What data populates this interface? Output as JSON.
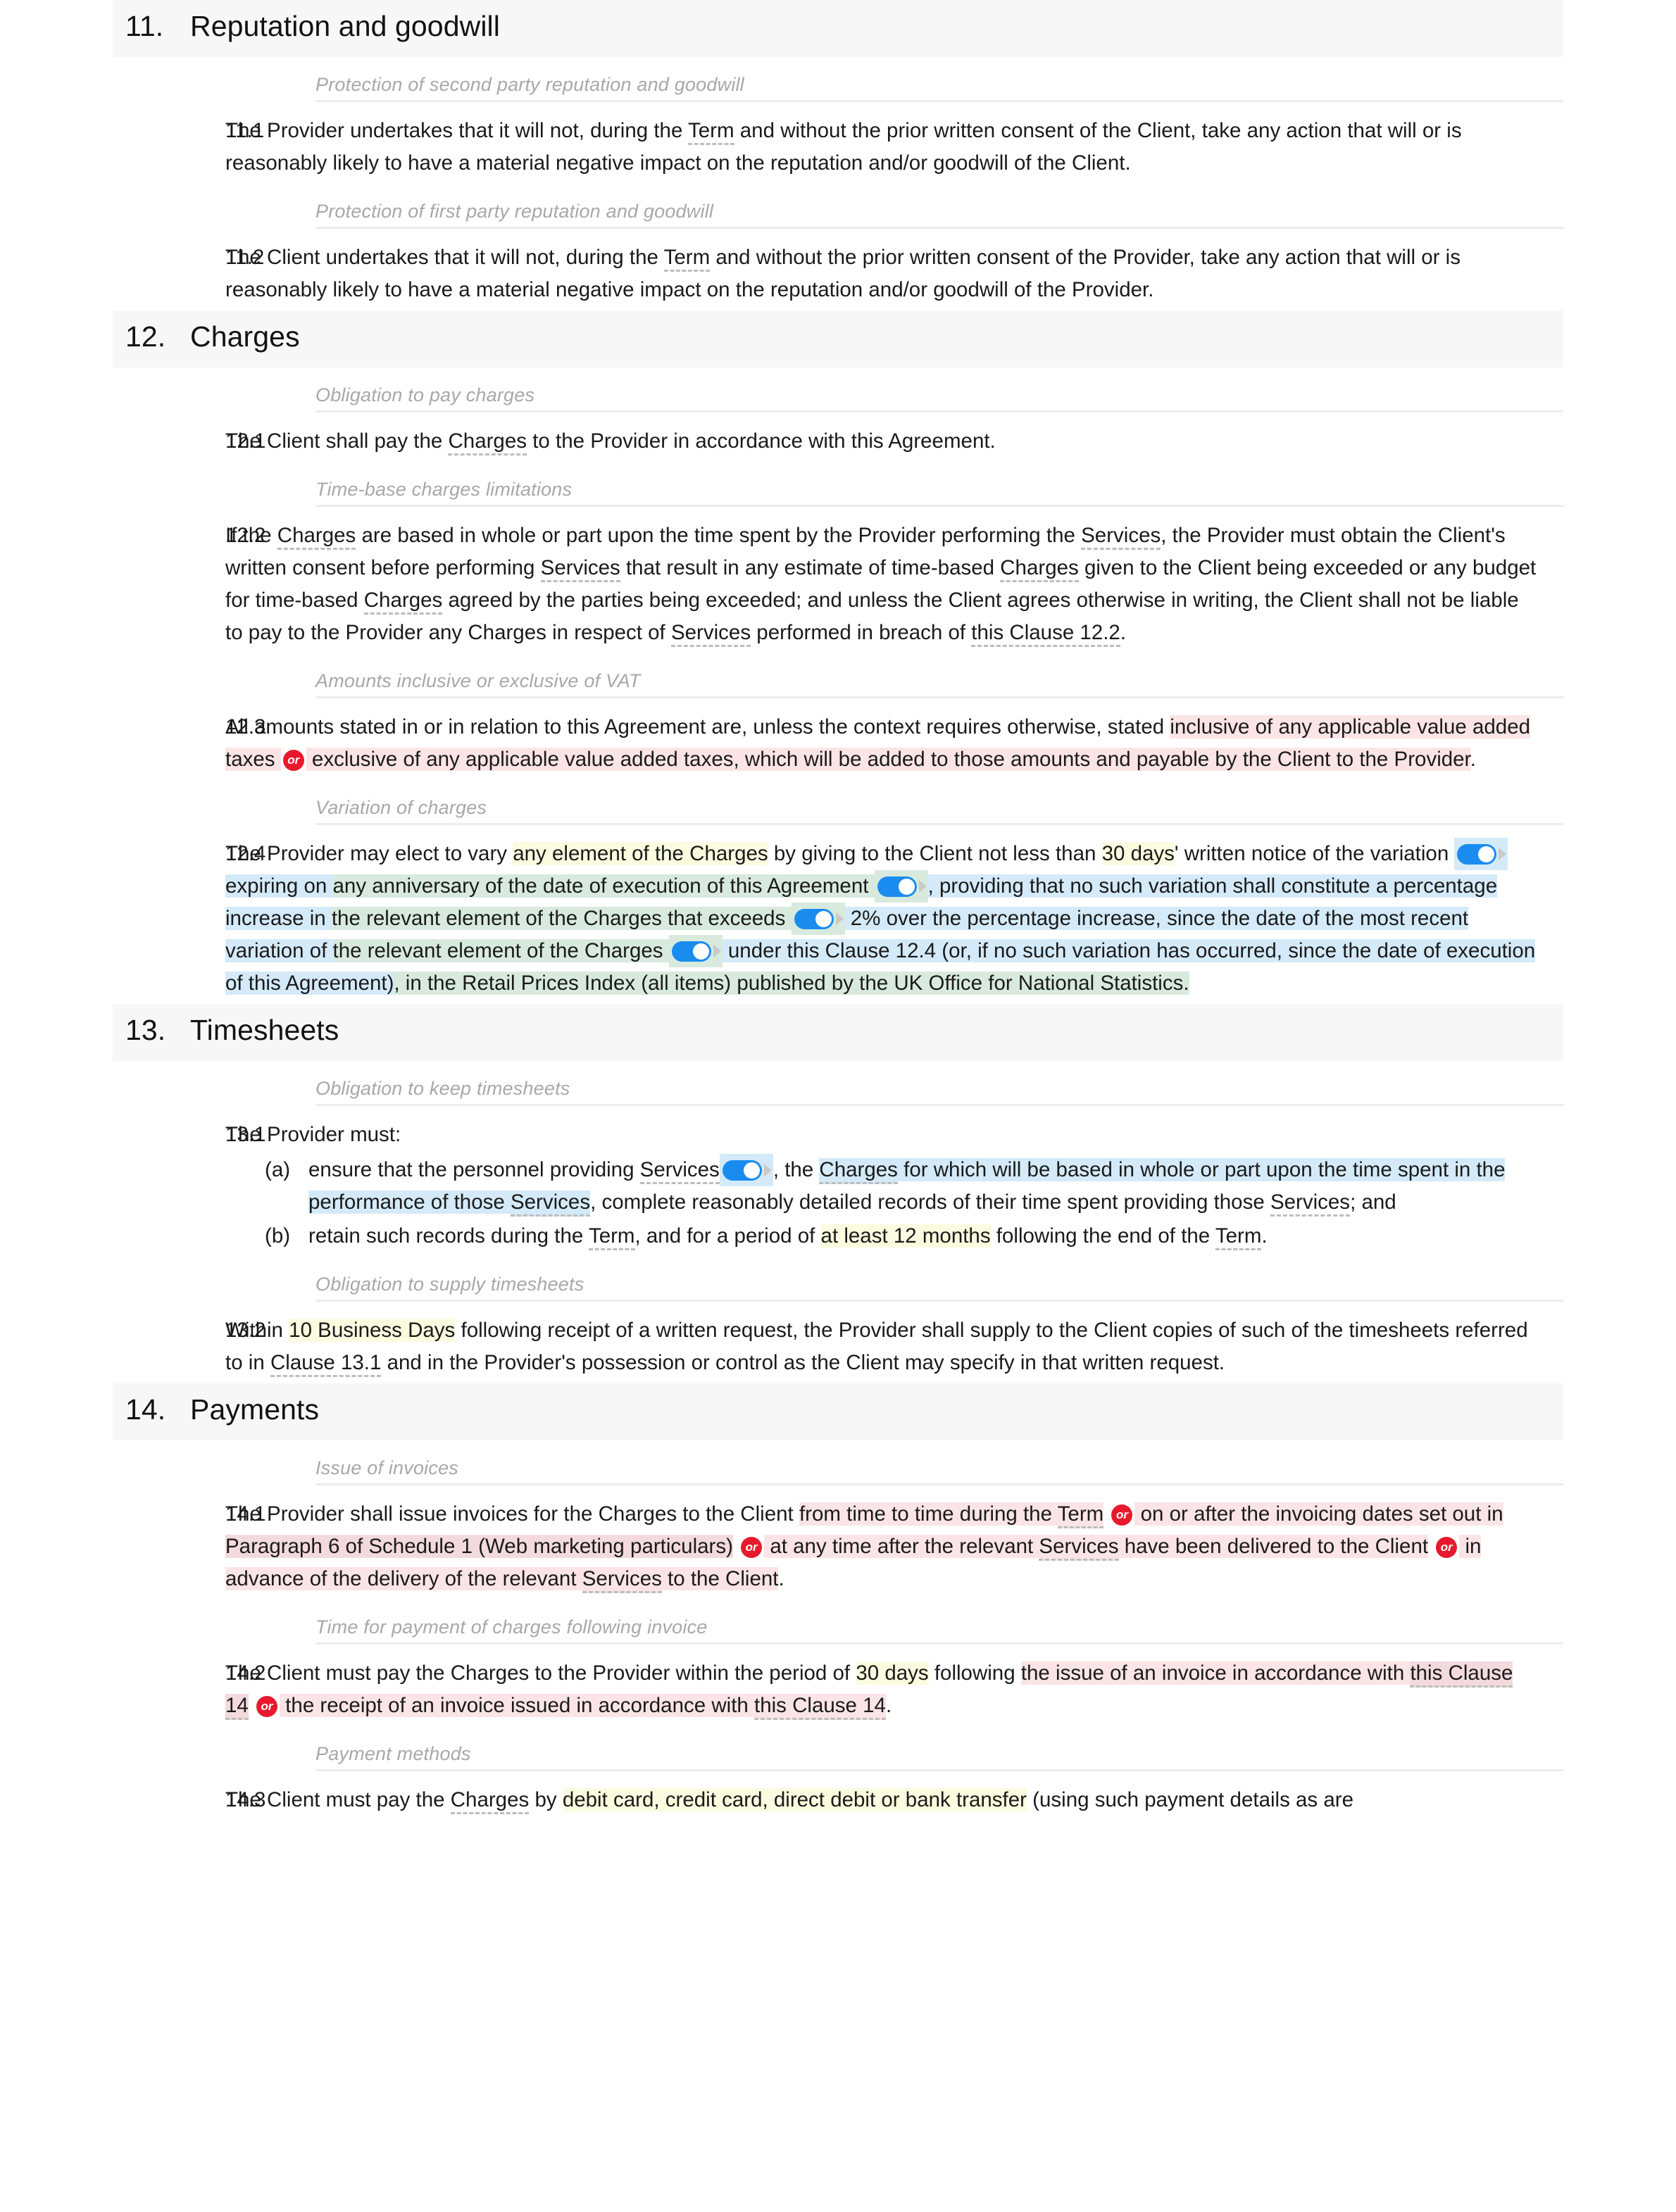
{
  "colors": {
    "accent_red": "#e8192c",
    "toggle_blue": "#1a8cf0",
    "highlight_yellow": "#fbfbe0",
    "highlight_pink": "#fbe4e6",
    "highlight_blue": "#d4eaf9",
    "highlight_green": "#d8eade",
    "section_band": "#f7f7f7",
    "subhead_grey": "#a8a8a8"
  },
  "icons": {
    "or_badge": "or-badge",
    "toggle_switch": "toggle-switch-on",
    "toggle_arrow": "caret-right-icon"
  },
  "sections": [
    {
      "number": "11.",
      "title": "Reputation and goodwill",
      "groups": [
        {
          "subhead": "Protection of second party reputation and goodwill",
          "clauses": [
            {
              "num": "11.1",
              "text_parts": [
                {
                  "t": "The Provider undertakes that it will not, during the "
                },
                {
                  "t": "Term",
                  "term": true
                },
                {
                  "t": " and without the prior written consent of the Client, take any action that will or is reasonably likely to have a material negative impact on the reputation and/or goodwill of the Client."
                }
              ]
            }
          ]
        },
        {
          "subhead": "Protection of first party reputation and goodwill",
          "clauses": [
            {
              "num": "11.2",
              "text_parts": [
                {
                  "t": "The Client undertakes that it will not, during the "
                },
                {
                  "t": "Term",
                  "term": true
                },
                {
                  "t": " and without the prior written consent of the Provider, take any action that will or is reasonably likely to have a material negative impact on the reputation and/or goodwill of the Provider."
                }
              ]
            }
          ]
        }
      ]
    },
    {
      "number": "12.",
      "title": "Charges",
      "groups": [
        {
          "subhead": "Obligation to pay charges",
          "clauses": [
            {
              "num": "12.1",
              "text_parts": [
                {
                  "t": "The Client shall pay the "
                },
                {
                  "t": "Charges",
                  "term": true
                },
                {
                  "t": " to the Provider in accordance with this Agreement."
                }
              ]
            }
          ]
        },
        {
          "subhead": "Time-base charges limitations",
          "clauses": [
            {
              "num": "12.2",
              "text_parts": [
                {
                  "t": "If the "
                },
                {
                  "t": "Charges",
                  "term": true
                },
                {
                  "t": " are based in whole or part upon the time spent by the Provider performing the "
                },
                {
                  "t": "Services",
                  "term": true
                },
                {
                  "t": ", the Provider must obtain the Client's written consent before performing "
                },
                {
                  "t": "Services",
                  "term": true
                },
                {
                  "t": " that result in any estimate of time-based "
                },
                {
                  "t": "Charges",
                  "term": true
                },
                {
                  "t": " given to the Client being exceeded or any budget for time-based "
                },
                {
                  "t": "Charges",
                  "term": true
                },
                {
                  "t": " agreed by the parties being exceeded; and unless the Client agrees otherwise in writing, the Client shall not be liable to pay to the Provider any Charges in respect of "
                },
                {
                  "t": "Services",
                  "term": true
                },
                {
                  "t": " performed in breach of "
                },
                {
                  "t": "this Clause 12.2",
                  "term": true
                },
                {
                  "t": "."
                }
              ]
            }
          ]
        },
        {
          "subhead": "Amounts inclusive or exclusive of VAT",
          "clauses": [
            {
              "num": "12.3",
              "text_parts": [
                {
                  "t": "All amounts stated in or in relation to this Agreement are, unless the context requires otherwise, stated "
                },
                {
                  "t": "inclusive of any applicable value added taxes ",
                  "hl": "pink"
                },
                {
                  "badge": "or"
                },
                {
                  "t": " exclusive of any applicable value added taxes, which will be added to those amounts and payable by the Client to the Provider",
                  "hl": "pink"
                },
                {
                  "t": "."
                }
              ]
            }
          ]
        },
        {
          "subhead": "Variation of charges",
          "clauses": [
            {
              "num": "12.4",
              "text_parts": [
                {
                  "t": "The Provider may elect to vary "
                },
                {
                  "t": "any element of the Charges",
                  "hl": "yellow"
                },
                {
                  "t": " by giving to the Client not less than "
                },
                {
                  "t": "30 days",
                  "hl": "yellow"
                },
                {
                  "t": "' written notice of the variation "
                },
                {
                  "toggle": true,
                  "hl": "blue"
                },
                {
                  "t": " expiring on ",
                  "hl": "blue"
                },
                {
                  "t": "any anniversary of the date of execution of this Agreement ",
                  "hl": "green"
                },
                {
                  "toggle": true,
                  "hl": "green"
                },
                {
                  "t": ", providing that no such variation shall constitute a percentage increase in ",
                  "hl": "blue"
                },
                {
                  "t": "the relevant element of the Charges that exceeds ",
                  "hl": "green"
                },
                {
                  "toggle": true,
                  "hl": "green"
                },
                {
                  "t": " 2% over",
                  "hl": "blue"
                },
                {
                  "t": " the percentage increase, since the date of the most recent variation of ",
                  "hl": "blue"
                },
                {
                  "t": "the relevant element of the Charges ",
                  "hl": "green"
                },
                {
                  "toggle": true,
                  "hl": "green"
                },
                {
                  "t": " under this Clause 12.4",
                  "hl": "blue"
                },
                {
                  "t": " (or, if no such variation has occurred, since the date of execution of this Agreement)",
                  "hl": "blue"
                },
                {
                  "t": ", in the Retail Prices Index (all items) published by the UK Office for National Statistics.",
                  "hl": "green"
                }
              ]
            }
          ]
        }
      ]
    },
    {
      "number": "13.",
      "title": "Timesheets",
      "groups": [
        {
          "subhead": "Obligation to keep timesheets",
          "clauses": [
            {
              "num": "13.1",
              "text_parts": [
                {
                  "t": "The Provider must:"
                }
              ],
              "sublist": [
                {
                  "label": "(a)",
                  "parts": [
                    {
                      "t": "ensure that the personnel providing "
                    },
                    {
                      "t": "Services",
                      "term": true
                    },
                    {
                      "toggle": true,
                      "hl": "blue"
                    },
                    {
                      "t": ", the "
                    },
                    {
                      "t": "Charges",
                      "term": true,
                      "hl": "blue"
                    },
                    {
                      "t": " for which will be based in whole or part upon the time spent in the performance of those ",
                      "hl": "blue"
                    },
                    {
                      "t": "Services",
                      "term": true,
                      "hl": "blue"
                    },
                    {
                      "t": ", complete reasonably detailed records of their time spent providing those "
                    },
                    {
                      "t": "Services",
                      "term": true
                    },
                    {
                      "t": "; and"
                    }
                  ]
                },
                {
                  "label": "(b)",
                  "parts": [
                    {
                      "t": "retain such records during the "
                    },
                    {
                      "t": "Term",
                      "term": true
                    },
                    {
                      "t": ", and for a period of "
                    },
                    {
                      "t": "at least 12 months",
                      "hl": "yellow"
                    },
                    {
                      "t": " following the end of the "
                    },
                    {
                      "t": "Term",
                      "term": true
                    },
                    {
                      "t": "."
                    }
                  ]
                }
              ]
            }
          ]
        },
        {
          "subhead": "Obligation to supply timesheets",
          "clauses": [
            {
              "num": "13.2",
              "text_parts": [
                {
                  "t": "Within "
                },
                {
                  "t": "10 Business Days",
                  "hl": "yellow"
                },
                {
                  "t": " following receipt of a written request, the Provider shall supply to the Client copies of such of the timesheets referred to in "
                },
                {
                  "t": "Clause 13.1",
                  "term": true
                },
                {
                  "t": " and in the Provider's possession or control as the Client may specify in that written request."
                }
              ]
            }
          ]
        }
      ]
    },
    {
      "number": "14.",
      "title": "Payments",
      "groups": [
        {
          "subhead": "Issue of invoices",
          "clauses": [
            {
              "num": "14.1",
              "text_parts": [
                {
                  "t": "The Provider shall issue invoices for the Charges to the Client "
                },
                {
                  "t": "from time to time during the ",
                  "hl": "pink"
                },
                {
                  "t": "Term",
                  "term": true,
                  "hl": "pink"
                },
                {
                  "t": " "
                },
                {
                  "badge": "or"
                },
                {
                  "t": " on or after the invoicing dates set out in ",
                  "hl": "pink"
                },
                {
                  "t": "Paragraph 6 of Schedule 1 (Web marketing particulars)",
                  "hl": "pink2"
                },
                {
                  "t": " "
                },
                {
                  "badge": "or"
                },
                {
                  "t": " at any time after the relevant ",
                  "hl": "pink"
                },
                {
                  "t": "Services",
                  "term": true,
                  "hl": "pink"
                },
                {
                  "t": " have been delivered to the Client",
                  "hl": "pink"
                },
                {
                  "t": " "
                },
                {
                  "badge": "or"
                },
                {
                  "t": " in advance of the delivery of the relevant ",
                  "hl": "pink"
                },
                {
                  "t": "Services",
                  "term": true,
                  "hl": "pink"
                },
                {
                  "t": " to the Client",
                  "hl": "pink"
                },
                {
                  "t": "."
                }
              ]
            }
          ]
        },
        {
          "subhead": "Time for payment of charges following invoice",
          "clauses": [
            {
              "num": "14.2",
              "text_parts": [
                {
                  "t": "The Client must pay the Charges to the Provider within the period of "
                },
                {
                  "t": "30 days",
                  "hl": "yellow"
                },
                {
                  "t": " following "
                },
                {
                  "t": "the issue of an invoice in accordance with ",
                  "hl": "pink"
                },
                {
                  "t": "this Clause 14",
                  "term": true,
                  "hl": "pink2"
                },
                {
                  "t": " "
                },
                {
                  "badge": "or"
                },
                {
                  "t": " the receipt of an invoice issued in accordance with ",
                  "hl": "pink"
                },
                {
                  "t": "this Clause 14",
                  "term": true,
                  "hl": "pink"
                },
                {
                  "t": "."
                }
              ]
            }
          ]
        },
        {
          "subhead": "Payment methods",
          "clauses": [
            {
              "num": "14.3",
              "text_parts": [
                {
                  "t": "The Client must pay the "
                },
                {
                  "t": "Charges",
                  "term": true
                },
                {
                  "t": " by "
                },
                {
                  "t": "debit card, credit card, direct debit or bank transfer",
                  "hl": "yellow"
                },
                {
                  "t": " (using such payment details as are"
                }
              ]
            }
          ]
        }
      ]
    }
  ]
}
